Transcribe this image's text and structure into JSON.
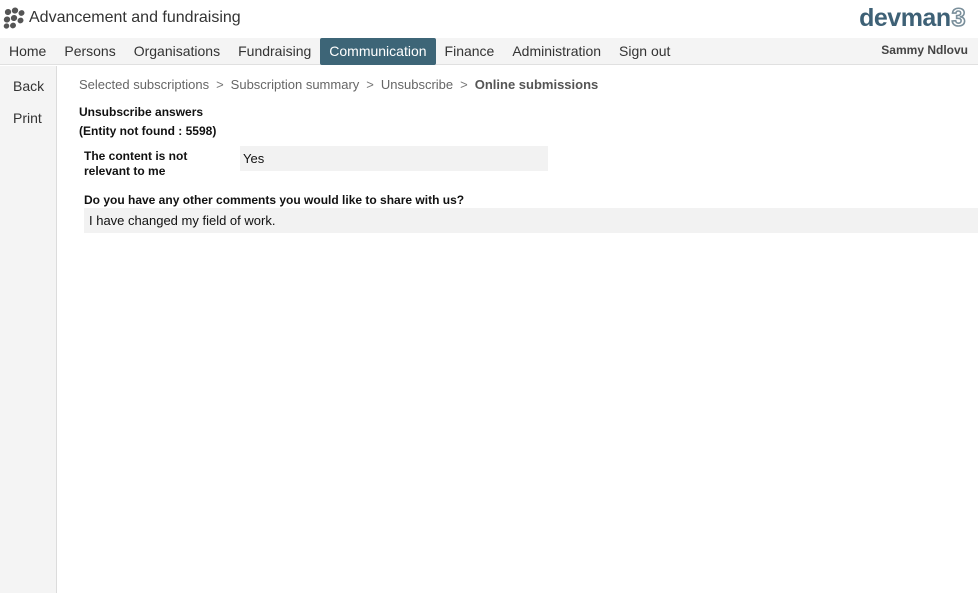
{
  "header": {
    "app_title": "Advancement and fundraising",
    "brand_text": "devman",
    "brand_number": "3",
    "logo_icon": "paw-dots-icon"
  },
  "nav": {
    "items": [
      {
        "label": "Home"
      },
      {
        "label": "Persons"
      },
      {
        "label": "Organisations"
      },
      {
        "label": "Fundraising"
      },
      {
        "label": "Communication"
      },
      {
        "label": "Finance"
      },
      {
        "label": "Administration"
      },
      {
        "label": "Sign out"
      }
    ],
    "active": "Communication",
    "user_name": "Sammy Ndlovu"
  },
  "sidebar": {
    "back_label": "Back",
    "print_label": "Print"
  },
  "breadcrumb": {
    "items": [
      "Selected subscriptions",
      "Subscription summary",
      "Unsubscribe"
    ],
    "separator": ">",
    "current": "Online submissions"
  },
  "content": {
    "section_title": "Unsubscribe answers",
    "entity_note": "(Entity not found : 5598)",
    "q1_label": "The content is not relevant to me",
    "q1_answer": "Yes",
    "q2_label": "Do you have any other comments you would like to share with us?",
    "q2_answer": "I have changed my field of work."
  },
  "colors": {
    "nav_active_bg": "#3d6577",
    "brand": "#3e6176",
    "panel_bg": "#f4f4f4",
    "answer_bg": "#f2f2f2"
  }
}
